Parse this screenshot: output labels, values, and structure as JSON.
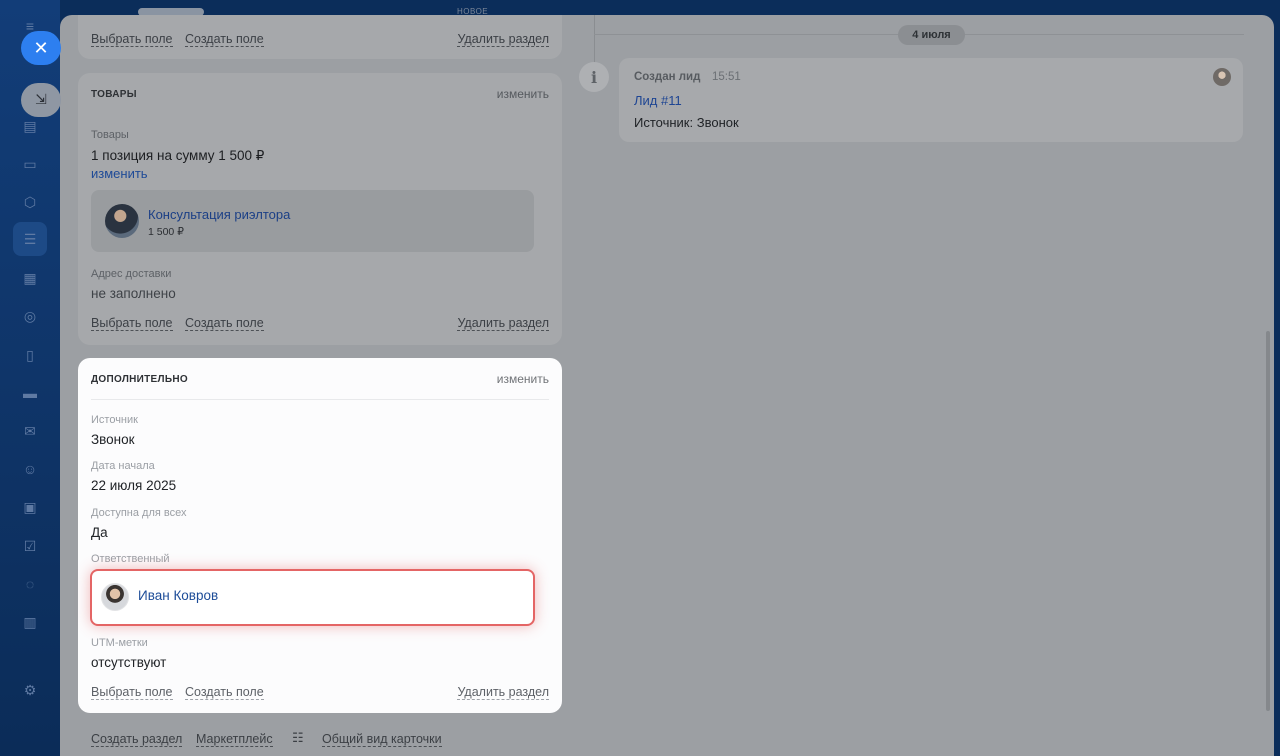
{
  "header": {
    "new_badge": "НОВОЕ"
  },
  "goods_card": {
    "title": "ТОВАРЫ",
    "edit": "изменить",
    "top_links": {
      "select": "Выбрать поле",
      "create": "Создать поле",
      "delete": "Удалить раздел"
    },
    "goods_label": "Товары",
    "goods_value": "1 позиция на сумму 1 500 ₽",
    "goods_edit": "изменить",
    "product": {
      "name": "Консультация риэлтора",
      "price": "1 500 ₽"
    },
    "delivery_label": "Адрес доставки",
    "delivery_value": "не заполнено",
    "links": {
      "select": "Выбрать поле",
      "create": "Создать поле",
      "delete": "Удалить раздел"
    }
  },
  "extra_card": {
    "title": "ДОПОЛНИТЕЛЬНО",
    "edit": "изменить",
    "fields": [
      {
        "label": "Источник",
        "value": "Звонок"
      },
      {
        "label": "Дата начала",
        "value": "22 июля 2025"
      },
      {
        "label": "Доступна для всех",
        "value": "Да"
      }
    ],
    "responsible_label": "Ответственный",
    "responsible_name": "Иван Ковров",
    "utm_label": "UTM-метки",
    "utm_value": "отсутствуют",
    "links": {
      "select": "Выбрать поле",
      "create": "Создать поле",
      "delete": "Удалить раздел"
    }
  },
  "footer": {
    "create_section": "Создать раздел",
    "marketplace": "Маркетплейс",
    "general_view": "Общий вид карточки"
  },
  "timeline": {
    "date": "4 июля",
    "event": {
      "title": "Создан лид",
      "time": "15:51",
      "link": "Лид #11",
      "source": "Источник: Звонок"
    }
  },
  "colors": {
    "accent": "#2d7ff0",
    "highlight_border": "#e46565",
    "link": "#1d4c98"
  }
}
